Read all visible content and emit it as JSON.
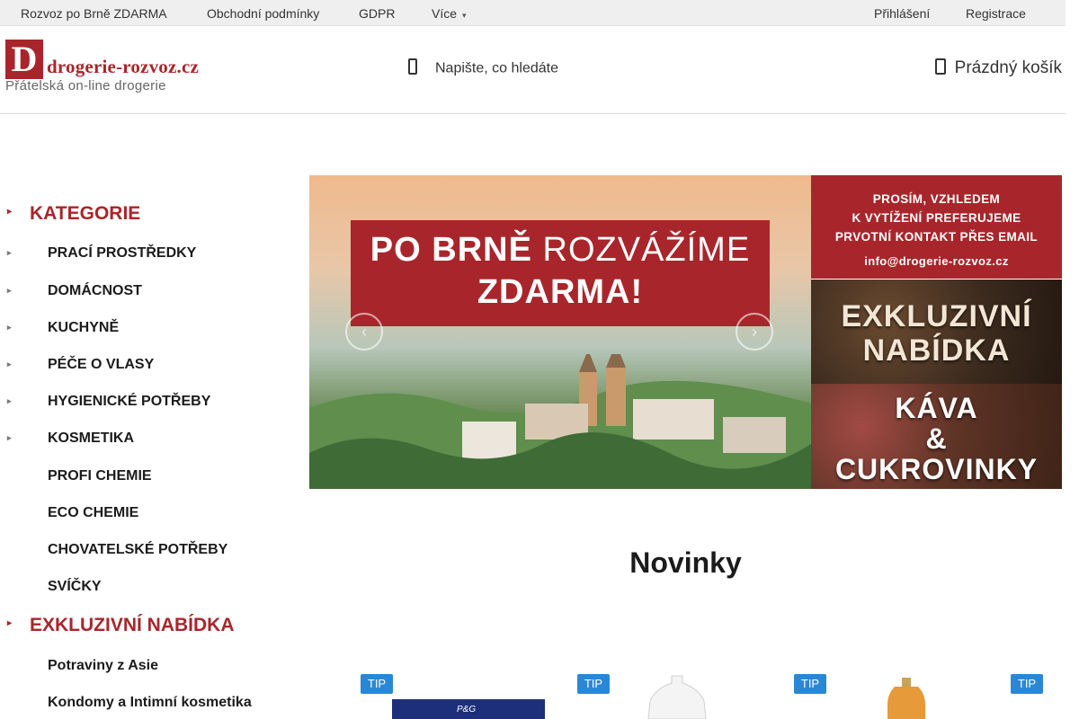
{
  "topbar": {
    "links": [
      "Rozvoz po Brně ZDARMA",
      "Obchodní podmínky",
      "GDPR"
    ],
    "more": "Více",
    "login": "Přihlášení",
    "register": "Registrace"
  },
  "logo": {
    "letter": "D",
    "name": "drogerie-rozvoz.cz",
    "tagline": "Přátelská on-line drogerie"
  },
  "search": {
    "placeholder": "Napište, co hledáte"
  },
  "cart": {
    "label": "Prázdný košík"
  },
  "sidebar": {
    "categories_title": "KATEGORIE",
    "items": [
      "PRACÍ PROSTŘEDKY",
      "DOMÁCNOST",
      "KUCHYNĚ",
      "PÉČE O VLASY",
      "HYGIENICKÉ POTŘEBY",
      "KOSMETIKA",
      "PROFI CHEMIE",
      "ECO CHEMIE",
      "CHOVATELSKÉ POTŘEBY",
      "SVÍČKY"
    ],
    "exclusive_title": "EXKLUZIVNÍ NABÍDKA",
    "exclusive_items": [
      "Potraviny z Asie",
      "Kondomy a Intimní kosmetika"
    ]
  },
  "banner": {
    "line1_bold": "PO BRNĚ",
    "line1_light": "ROZVÁŽÍME",
    "line2": "ZDARMA!"
  },
  "promos": {
    "contact_lines": [
      "PROSÍM, VZHLEDEM",
      "K VYTÍŽENÍ PREFERUJEME",
      "PRVOTNÍ KONTAKT PŘES EMAIL",
      "info@drogerie-rozvoz.cz"
    ],
    "exclusive_lines": [
      "EXKLUZIVNÍ",
      "NABÍDKA"
    ],
    "coffee_lines": [
      "KÁVA",
      "&",
      "CUKROVINKY"
    ]
  },
  "novinky": {
    "title": "Novinky"
  },
  "products": [
    {
      "badge": "TIP",
      "brand": "P&G"
    },
    {
      "badge": "TIP"
    },
    {
      "badge": "TIP"
    },
    {
      "badge": "TIP"
    }
  ],
  "colors": {
    "brand_red": "#a8262b",
    "tip_blue": "#2a87d6",
    "topbar_bg": "#efefef"
  }
}
